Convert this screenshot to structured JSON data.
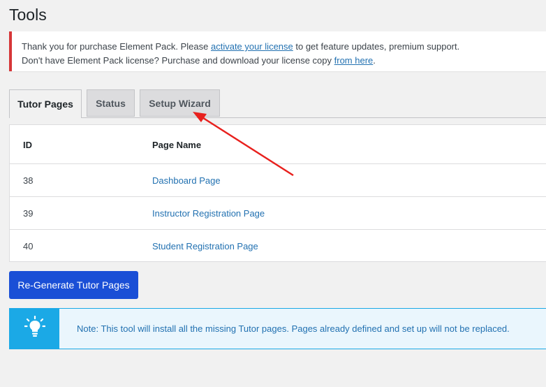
{
  "page": {
    "title": "Tools"
  },
  "notice": {
    "line1_pre": "Thank you for purchase Element Pack. Please ",
    "line1_link": "activate your license",
    "line1_post": " to get feature updates, premium support.",
    "line2_pre": "Don't have Element Pack license? Purchase and download your license copy ",
    "line2_link": "from here",
    "line2_post": ".",
    "accent": "#d63638"
  },
  "tabs": [
    {
      "label": "Tutor Pages",
      "active": true
    },
    {
      "label": "Status",
      "active": false
    },
    {
      "label": "Setup Wizard",
      "active": false
    }
  ],
  "table": {
    "headers": [
      "ID",
      "Page Name"
    ],
    "rows": [
      {
        "id": "38",
        "name": "Dashboard Page"
      },
      {
        "id": "39",
        "name": "Instructor Registration Page"
      },
      {
        "id": "40",
        "name": "Student Registration Page"
      }
    ]
  },
  "actions": {
    "regenerate_label": "Re-Generate Tutor Pages",
    "button_color": "#1a4fd6"
  },
  "info": {
    "icon": "lightbulb-icon",
    "text": "Note: This tool will install all the missing Tutor pages. Pages already defined and set up will not be replaced.",
    "accent": "#1ba9e6"
  },
  "annotation": {
    "arrow_color": "#e8201d",
    "points_to": "Setup Wizard"
  }
}
